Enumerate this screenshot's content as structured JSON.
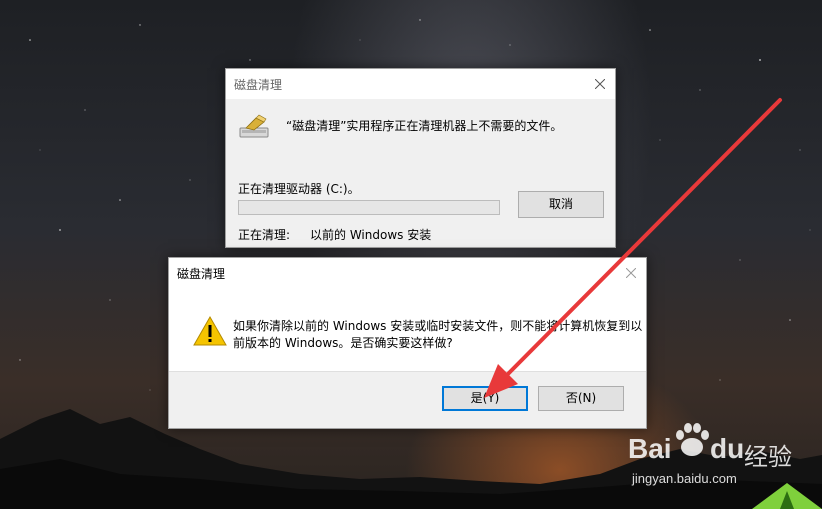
{
  "progress_dialog": {
    "title": "磁盘清理",
    "message": "“磁盘清理”实用程序正在清理机器上不需要的文件。",
    "drive_text": "正在清理驱动器 (C:)。",
    "cancel_label": "取消",
    "cleaning_label": "正在清理:",
    "cleaning_item": "以前的 Windows 安装",
    "progress": 0.0
  },
  "confirm_dialog": {
    "title": "磁盘清理",
    "message_line1": "如果你清除以前的 Windows 安装或临时安装文件，则不能将计算机恢复到以",
    "message_line2": "前版本的 Windows。是否确实要这样做?",
    "yes_label": "是(Y)",
    "no_label": "否(N)"
  },
  "watermark": {
    "brand": "Bai",
    "brand2": "du",
    "suffix": "经验",
    "url": "jingyan.baidu.com"
  },
  "colors": {
    "arrow": "#e8393a",
    "focus": "#0078d7",
    "warning": "#f5c400"
  }
}
